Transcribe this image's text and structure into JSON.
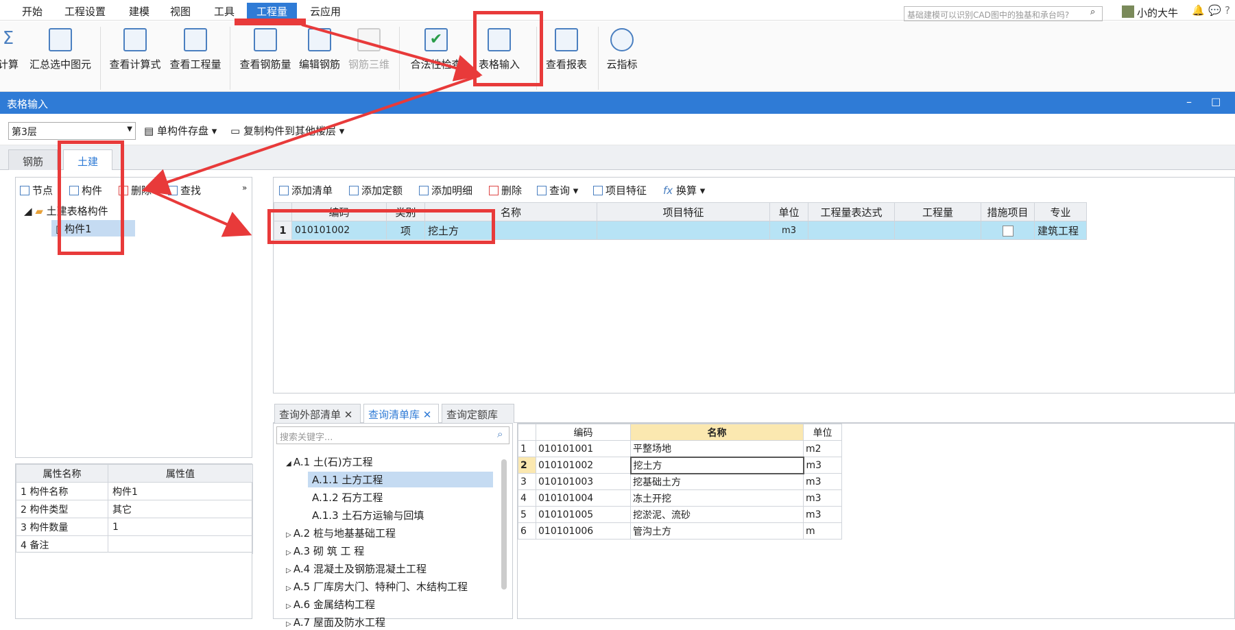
{
  "menu": {
    "items": [
      "开始",
      "工程设置",
      "建模",
      "视图",
      "工具",
      "工程量",
      "云应用"
    ],
    "active": "工程量",
    "search_placeholder": "基础建模可以识别CAD图中的独基和承台吗?",
    "user": "小的大牛",
    "help": "?"
  },
  "ribbon": {
    "buttons": [
      "计算",
      "汇总选中图元",
      "查看计算式",
      "查看工程量",
      "查看钢筋量",
      "编辑钢筋",
      "钢筋三维",
      "合法性检查",
      "表格输入",
      "查看报表",
      "云指标"
    ]
  },
  "panel": {
    "title": "表格输入",
    "minimize": "–",
    "maximize": "□",
    "floor": "第3层",
    "save_component": "单构件存盘",
    "copy_component": "复制构件到其他楼层"
  },
  "tabs": [
    "钢筋",
    "土建"
  ],
  "left_toolbar": [
    "节点",
    "构件",
    "删除",
    "查找"
  ],
  "tree": {
    "root": "土建表格构件",
    "child": "构件1"
  },
  "properties": {
    "headers": [
      "属性名称",
      "属性值"
    ],
    "rows": [
      [
        "1",
        "构件名称",
        "构件1"
      ],
      [
        "2",
        "构件类型",
        "其它"
      ],
      [
        "3",
        "构件数量",
        "1"
      ],
      [
        "4",
        "备注",
        ""
      ]
    ]
  },
  "right_toolbar": [
    "添加清单",
    "添加定额",
    "添加明细",
    "删除",
    "查询",
    "项目特征",
    "换算"
  ],
  "grid": {
    "headers": [
      "编码",
      "类别",
      "名称",
      "项目特征",
      "单位",
      "工程量表达式",
      "工程量",
      "措施项目",
      "专业"
    ],
    "rows": [
      {
        "num": "1",
        "code": "010101002",
        "type": "项",
        "name": "挖土方",
        "feature": "",
        "unit": "m3",
        "expr": "",
        "qty": "",
        "measure": false,
        "major": "建筑工程"
      }
    ]
  },
  "bottom_tabs": [
    "查询外部清单",
    "查询清单库",
    "查询定额库"
  ],
  "bottom_active": "查询清单库",
  "lib_search_placeholder": "搜索关键字...",
  "lib_tree": [
    {
      "label": "A.1  土(石)方工程",
      "level": 0,
      "open": true
    },
    {
      "label": "A.1.1  土方工程",
      "level": 1,
      "selected": true
    },
    {
      "label": "A.1.2  石方工程",
      "level": 1
    },
    {
      "label": "A.1.3  土石方运输与回填",
      "level": 1
    },
    {
      "label": "A.2  桩与地基基础工程",
      "level": 0
    },
    {
      "label": "A.3  砌 筑 工 程",
      "level": 0
    },
    {
      "label": "A.4  混凝土及钢筋混凝土工程",
      "level": 0
    },
    {
      "label": "A.5  厂库房大门、特种门、木结构工程",
      "level": 0
    },
    {
      "label": "A.6  金属结构工程",
      "level": 0
    },
    {
      "label": "A.7  屋面及防水工程",
      "level": 0
    }
  ],
  "lib_table": {
    "headers": [
      "编码",
      "名称",
      "单位"
    ],
    "rows": [
      [
        "1",
        "010101001",
        "平整场地",
        "m2"
      ],
      [
        "2",
        "010101002",
        "挖土方",
        "m3"
      ],
      [
        "3",
        "010101003",
        "挖基础土方",
        "m3"
      ],
      [
        "4",
        "010101004",
        "冻土开挖",
        "m3"
      ],
      [
        "5",
        "010101005",
        "挖淤泥、流砂",
        "m3"
      ],
      [
        "6",
        "010101006",
        "管沟土方",
        "m"
      ]
    ]
  },
  "colors": {
    "accent": "#2f7bd6",
    "highlight_row": "#b7e3f5",
    "annotation": "#e83a3a"
  }
}
